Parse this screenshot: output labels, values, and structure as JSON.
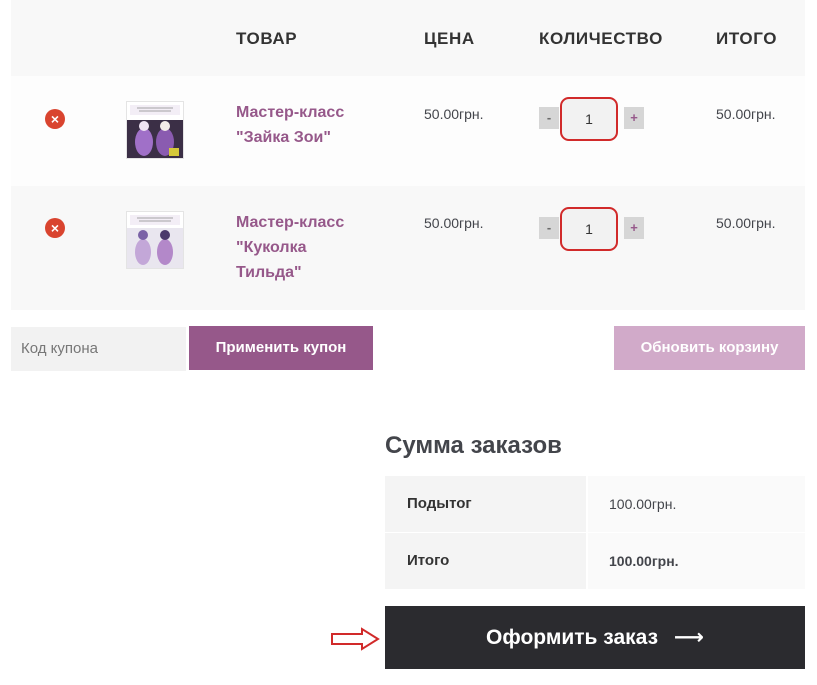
{
  "table": {
    "headers": {
      "product": "ТОВАР",
      "price": "ЦЕНА",
      "quantity": "КОЛИЧЕСТВО",
      "total": "ИТОГО"
    },
    "rows": [
      {
        "name": "Мастер-класс \"Зайка Зои\"",
        "price": "50.00грн.",
        "quantity": "1",
        "subtotal": "50.00грн.",
        "thumb_theme": "#8a5bb0"
      },
      {
        "name": "Мастер-класс \"Куколка Тильда\"",
        "price": "50.00грн.",
        "quantity": "1",
        "subtotal": "50.00грн.",
        "thumb_theme": "#7a62a6"
      }
    ],
    "remove_icon": "×",
    "minus_label": "-",
    "plus_label": "+"
  },
  "coupon": {
    "placeholder": "Код купона",
    "apply_label": "Применить купон",
    "update_label": "Обновить корзину"
  },
  "totals": {
    "title": "Сумма заказов",
    "subtotal_label": "Подытог",
    "subtotal_value": "100.00грн.",
    "total_label": "Итого",
    "total_value": "100.00грн."
  },
  "checkout": {
    "label": "Оформить заказ",
    "arrow": "⟶"
  },
  "colors": {
    "brand": "#96588a",
    "annotation": "#d12a2a",
    "checkout_bg": "#2b2b2f"
  }
}
